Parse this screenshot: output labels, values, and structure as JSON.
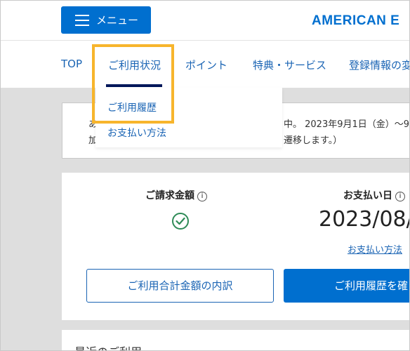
{
  "header": {
    "menu_label": "メニュー",
    "logo_text": "AMERICAN E"
  },
  "nav": {
    "items": [
      {
        "label": "TOP"
      },
      {
        "label": "ご利用状況"
      },
      {
        "label": "ポイント"
      },
      {
        "label": "特典・サービス"
      },
      {
        "label": "登録情報の変"
      }
    ],
    "active": "ご利用状況"
  },
  "dropdown": {
    "items": [
      {
        "label": "ご利用履歴"
      },
      {
        "label": "お支払い方法"
      }
    ]
  },
  "notice": {
    "line1_left": "あ",
    "line1_right": "中。 2023年9月1日（金）～9",
    "line2_left": "加",
    "line2_right": "遷移します。）"
  },
  "billing": {
    "amount_label": "ご請求金額",
    "payment_date_label": "お支払い日",
    "payment_date": "2023/08/",
    "payment_method_link": "お支払い方法",
    "breakdown_button": "ご利用合計金額の内訳",
    "history_button": "ご利用履歴を確"
  },
  "recent": {
    "title": "最近のご利用"
  },
  "colors": {
    "brand_blue": "#006fcf",
    "link_blue": "#1a64b4",
    "active_underline": "#00175a",
    "highlight": "#f7b52c",
    "success_green": "#2e8b57"
  }
}
